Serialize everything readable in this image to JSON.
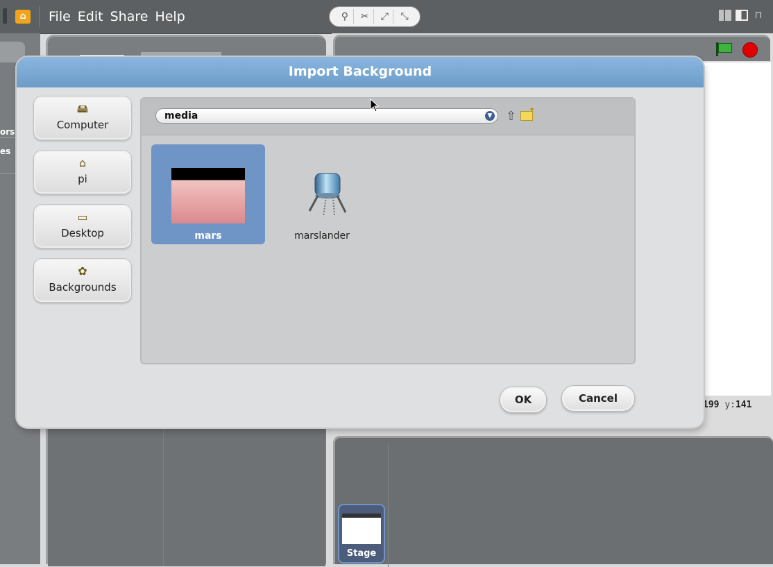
{
  "menubar": {
    "items": [
      "File",
      "Edit",
      "Share",
      "Help"
    ],
    "tool_icons": [
      "stamp-icon",
      "scissors-icon",
      "grow-icon",
      "shrink-icon"
    ],
    "layout_icons": [
      "small-stage-icon",
      "normal-stage-icon",
      "presentation-icon"
    ]
  },
  "left_tabs": {
    "tab_a": "ors",
    "tab_b": "es"
  },
  "stage": {
    "coords": {
      "x_value": "199",
      "y_label": "y:",
      "y_value": "141"
    },
    "thumb_label": "Stage",
    "colors": {
      "go_flag": "#3eb43e",
      "stop": "#e00000"
    }
  },
  "dialog": {
    "title": "Import Background",
    "places": [
      {
        "label": "Computer",
        "icon": "computer-icon"
      },
      {
        "label": "pi",
        "icon": "home-icon"
      },
      {
        "label": "Desktop",
        "icon": "folder-icon"
      },
      {
        "label": "Backgrounds",
        "icon": "backgrounds-icon"
      }
    ],
    "path": "media",
    "files": [
      {
        "name": "mars",
        "selected": true
      },
      {
        "name": "marslander",
        "selected": false
      }
    ],
    "ok_label": "OK",
    "cancel_label": "Cancel",
    "colors": {
      "title_bar": "#7aa9d6",
      "selection": "#6e95c6"
    }
  }
}
